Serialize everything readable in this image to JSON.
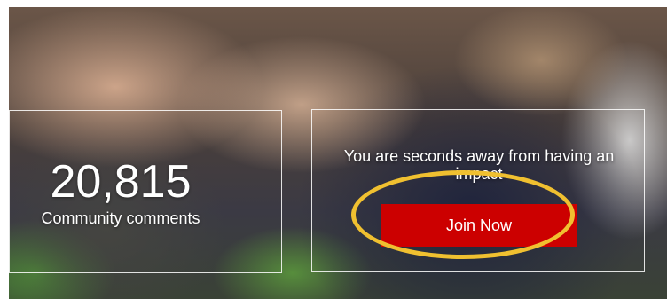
{
  "stat": {
    "number": "20,815",
    "label": "Community comments"
  },
  "cta": {
    "text": "You are seconds away from having an impact",
    "button_label": "Join Now"
  },
  "colors": {
    "button_background": "#cc0000",
    "highlight_ring": "#f0c030",
    "text": "#ffffff"
  }
}
